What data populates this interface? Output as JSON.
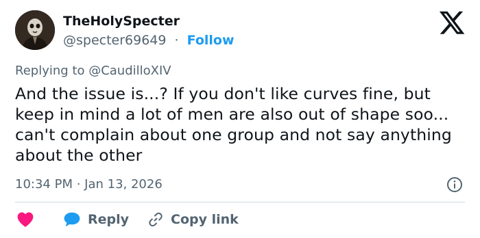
{
  "user": {
    "display_name": "TheHolySpecter",
    "handle": "@specter69649",
    "separator": "·",
    "follow_label": "Follow"
  },
  "brand": {
    "logo_icon": "x-logo-icon"
  },
  "reply_context": {
    "prefix": "Replying to ",
    "mention": "@CaudilloXIV"
  },
  "tweet": {
    "text": "And the issue is...? If you don't like curves fine, but keep in mind a lot of men are also out of shape soo... can't complain about one group and not say anything about the other",
    "timestamp": "10:34 PM · Jan 13, 2026"
  },
  "actions": {
    "like_icon": "heart-icon",
    "reply_label": "Reply",
    "reply_icon": "speech-bubble-icon",
    "copy_label": "Copy link",
    "copy_icon": "link-icon"
  },
  "colors": {
    "accent": "#1d9bf0",
    "like": "#f91880",
    "muted_text": "#536471",
    "primary_text": "#0f1419",
    "divider": "#cfd9de"
  }
}
